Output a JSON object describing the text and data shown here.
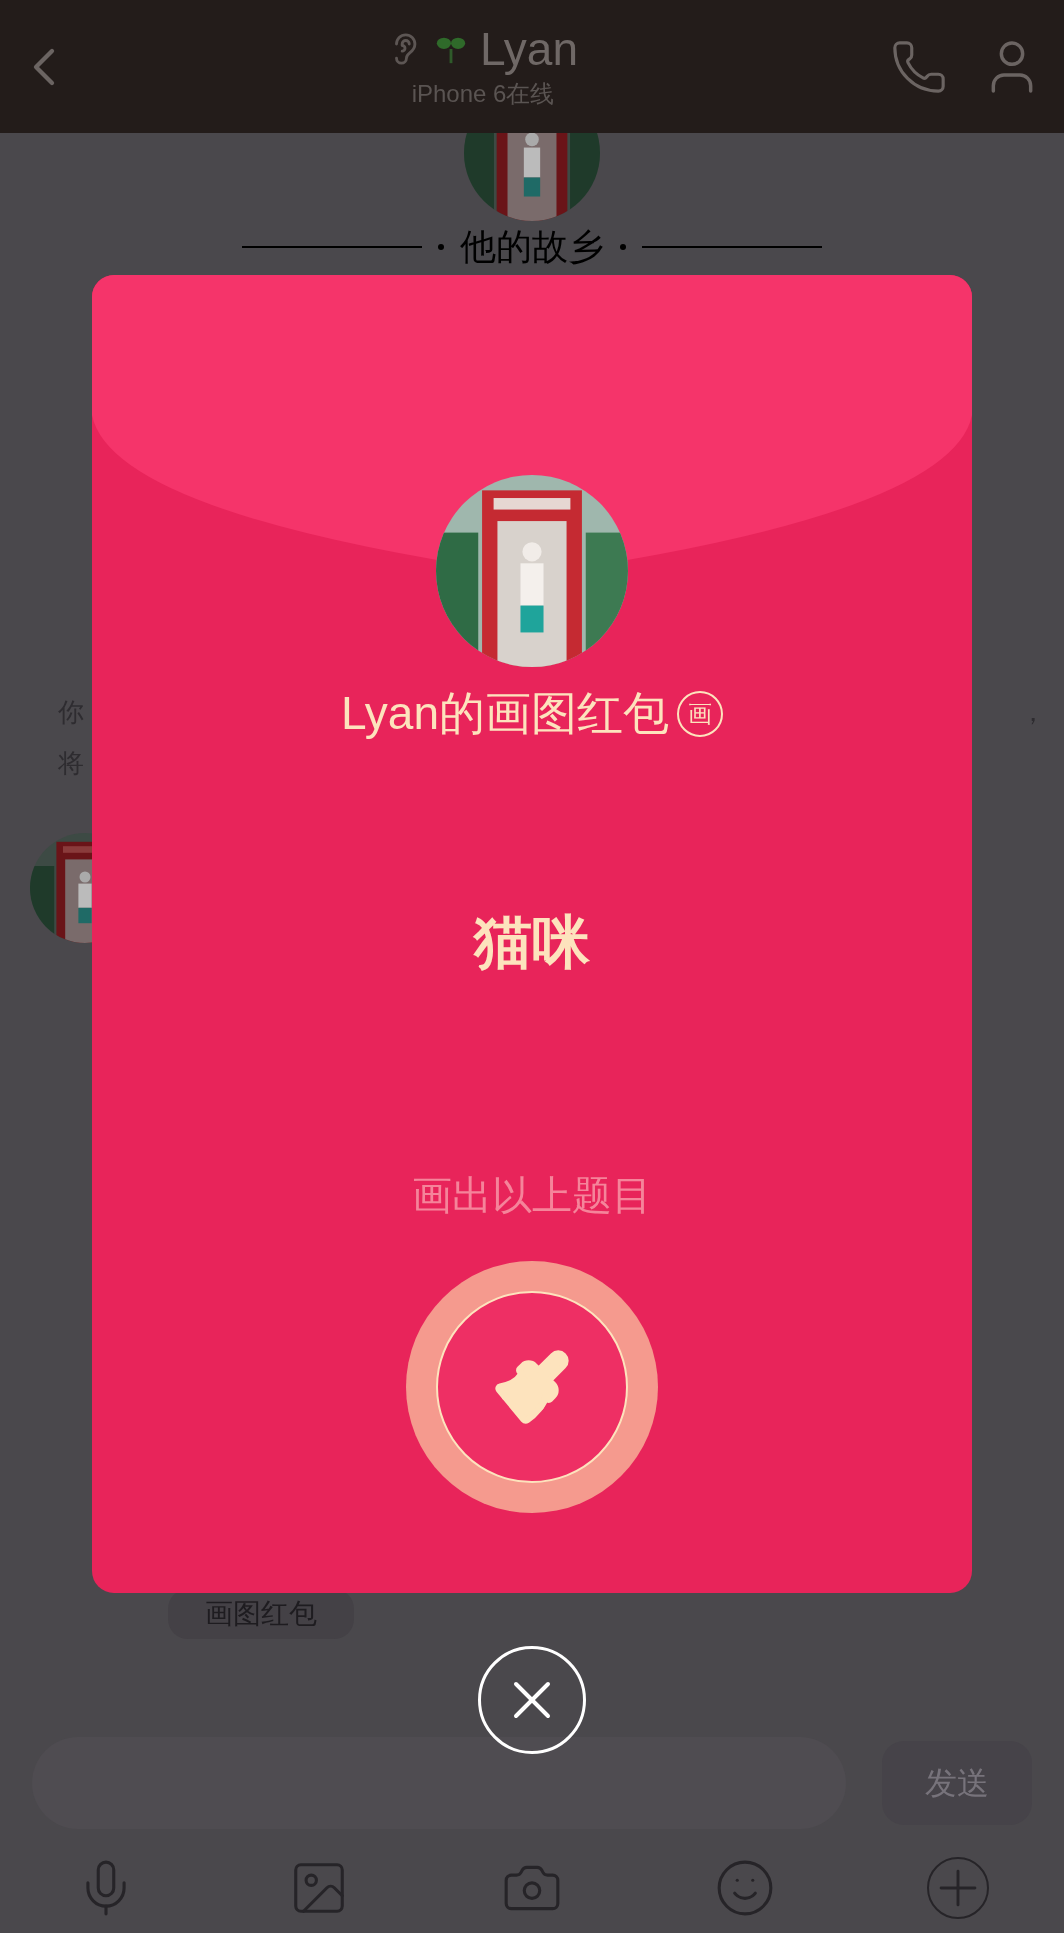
{
  "header": {
    "name": "Lyan",
    "status": "iPhone 6在线"
  },
  "chat": {
    "divider_text": "他的故乡",
    "fragments": [
      "你",
      "将"
    ],
    "right_fragment": "，",
    "bubble": "画图红包"
  },
  "red_packet": {
    "title": "Lyan的画图红包",
    "badge": "画",
    "topic": "猫咪",
    "hint": "画出以上题目"
  },
  "composer": {
    "send": "发送"
  }
}
